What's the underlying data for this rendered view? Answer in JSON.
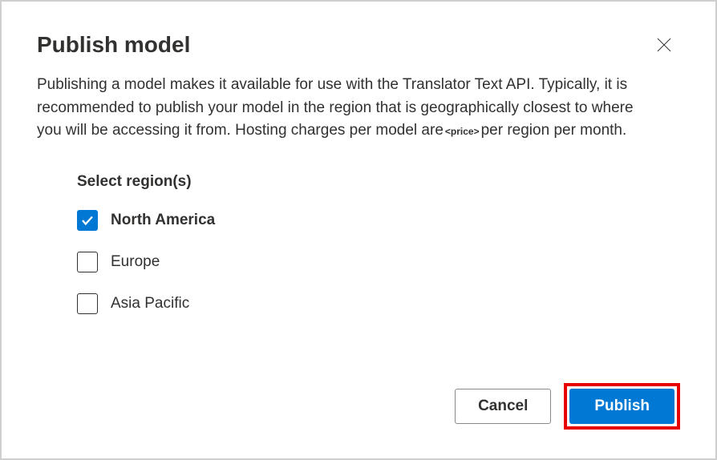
{
  "dialog": {
    "title": "Publish model",
    "description_pre": "Publishing a model makes it available for use with the Translator Text API. Typically, it is recommended to publish your model in the region that is geographically closest to where you will be accessing it from. Hosting charges per model are",
    "price_placeholder": "<price>",
    "description_post": "per region per month."
  },
  "regions": {
    "label": "Select region(s)",
    "items": [
      {
        "label": "North America",
        "checked": true
      },
      {
        "label": "Europe",
        "checked": false
      },
      {
        "label": "Asia Pacific",
        "checked": false
      }
    ]
  },
  "buttons": {
    "cancel": "Cancel",
    "publish": "Publish"
  }
}
